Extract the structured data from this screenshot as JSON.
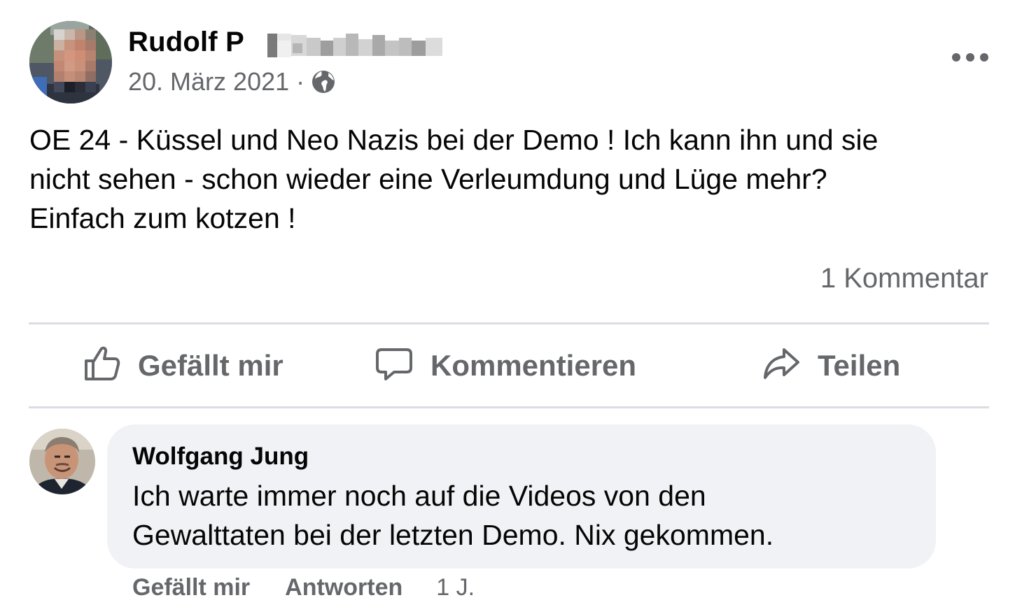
{
  "post": {
    "author_name": "Rudolf P",
    "date": "20. März 2021",
    "separator": "·",
    "privacy_icon": "globe-icon",
    "more_icon": "more-dots-icon",
    "text": "OE 24 - Küssel und Neo Nazis bei der Demo ! Ich kann ihn und sie\nnicht sehen - schon wieder eine Verleumdung und Lüge mehr?\nEinfach zum kotzen !",
    "comment_count": "1 Kommentar"
  },
  "actions": {
    "like_label": "Gefällt mir",
    "like_icon": "thumbs-up-icon",
    "comment_label": "Kommentieren",
    "comment_icon": "speech-bubble-icon",
    "share_label": "Teilen",
    "share_icon": "share-arrow-icon"
  },
  "comment": {
    "author_name": "Wolfgang Jung",
    "text": "Ich warte immer noch auf die Videos von den\nGewalttaten bei der letzten Demo. Nix gekommen.",
    "like_label": "Gefällt mir",
    "reply_label": "Antworten",
    "time": "1 J."
  },
  "colors": {
    "text_primary": "#050505",
    "text_secondary": "#65676b",
    "divider": "#dadde1",
    "bubble_bg": "#f0f2f5"
  }
}
